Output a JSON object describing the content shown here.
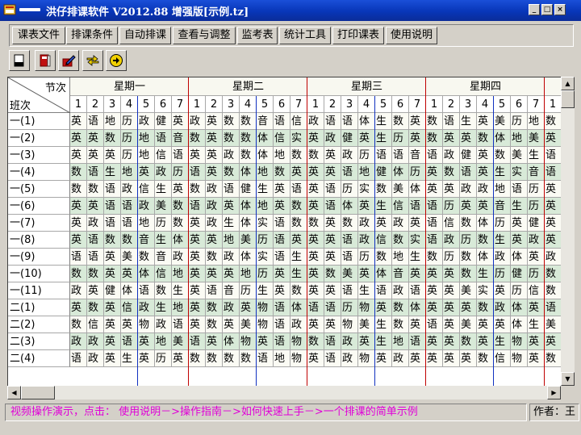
{
  "window": {
    "title": "洪仔排课软件 V2012.88 增强版[示例.tz]",
    "controls": [
      "_",
      "□",
      "×"
    ]
  },
  "menu": {
    "items": [
      "课表文件",
      "排课条件",
      "自动排课",
      "查看与调整",
      "监考表",
      "统计工具",
      "打印课表",
      "使用说明"
    ]
  },
  "toolbar": {
    "tools": [
      "new-doc-icon",
      "book-icon",
      "edit-pencil-icon",
      "swap-arrows-icon",
      "arrow-right-circle-icon"
    ]
  },
  "grid": {
    "corner_top": "节次",
    "corner_bottom": "班次",
    "days": [
      "星期一",
      "星期二",
      "星期三",
      "星期四"
    ],
    "periods_per_day": [
      "1",
      "2",
      "3",
      "4",
      "5",
      "6",
      "7"
    ],
    "extra_period": "1",
    "rows": [
      {
        "label": "一(1)",
        "cells": [
          "英",
          "语",
          "地",
          "历",
          "政",
          "健",
          "英",
          "政",
          "英",
          "数",
          "数",
          "音",
          "语",
          "信",
          "政",
          "语",
          "语",
          "体",
          "生",
          "数",
          "英",
          "数",
          "语",
          "生",
          "英",
          "美",
          "历",
          "地",
          "数"
        ]
      },
      {
        "label": "一(2)",
        "cells": [
          "英",
          "英",
          "数",
          "历",
          "地",
          "语",
          "音",
          "数",
          "英",
          "数",
          "数",
          "体",
          "信",
          "实",
          "英",
          "政",
          "健",
          "英",
          "生",
          "历",
          "英",
          "数",
          "英",
          "英",
          "数",
          "体",
          "地",
          "美",
          "英"
        ]
      },
      {
        "label": "一(3)",
        "cells": [
          "英",
          "英",
          "英",
          "历",
          "地",
          "信",
          "语",
          "英",
          "英",
          "政",
          "数",
          "体",
          "地",
          "数",
          "数",
          "英",
          "政",
          "历",
          "语",
          "语",
          "音",
          "语",
          "政",
          "健",
          "英",
          "数",
          "美",
          "生",
          "语"
        ]
      },
      {
        "label": "一(4)",
        "cells": [
          "数",
          "语",
          "生",
          "地",
          "英",
          "政",
          "历",
          "语",
          "英",
          "数",
          "体",
          "地",
          "数",
          "英",
          "英",
          "英",
          "语",
          "地",
          "健",
          "体",
          "历",
          "英",
          "数",
          "语",
          "英",
          "生",
          "实",
          "音",
          "语"
        ]
      },
      {
        "label": "一(5)",
        "cells": [
          "数",
          "数",
          "语",
          "政",
          "信",
          "生",
          "英",
          "数",
          "政",
          "语",
          "健",
          "生",
          "英",
          "语",
          "英",
          "语",
          "历",
          "实",
          "数",
          "美",
          "体",
          "英",
          "英",
          "政",
          "政",
          "地",
          "语",
          "历",
          "英"
        ]
      },
      {
        "label": "一(6)",
        "cells": [
          "英",
          "英",
          "语",
          "语",
          "政",
          "美",
          "数",
          "语",
          "政",
          "英",
          "体",
          "地",
          "英",
          "数",
          "英",
          "语",
          "体",
          "英",
          "生",
          "信",
          "语",
          "语",
          "历",
          "英",
          "英",
          "音",
          "生",
          "历",
          "英"
        ]
      },
      {
        "label": "一(7)",
        "cells": [
          "英",
          "政",
          "语",
          "语",
          "地",
          "历",
          "数",
          "英",
          "政",
          "生",
          "体",
          "实",
          "语",
          "数",
          "数",
          "英",
          "数",
          "政",
          "英",
          "政",
          "英",
          "语",
          "信",
          "数",
          "体",
          "历",
          "英",
          "健",
          "英"
        ]
      },
      {
        "label": "一(8)",
        "cells": [
          "英",
          "语",
          "数",
          "数",
          "音",
          "生",
          "体",
          "英",
          "英",
          "地",
          "美",
          "历",
          "语",
          "英",
          "英",
          "英",
          "语",
          "政",
          "信",
          "数",
          "实",
          "语",
          "政",
          "历",
          "数",
          "生",
          "英",
          "政",
          "英"
        ]
      },
      {
        "label": "一(9)",
        "cells": [
          "语",
          "语",
          "英",
          "美",
          "数",
          "音",
          "政",
          "英",
          "数",
          "政",
          "体",
          "实",
          "语",
          "生",
          "英",
          "英",
          "语",
          "历",
          "数",
          "地",
          "生",
          "数",
          "历",
          "数",
          "体",
          "政",
          "体",
          "英",
          "政"
        ]
      },
      {
        "label": "一(10)",
        "cells": [
          "数",
          "数",
          "英",
          "英",
          "体",
          "信",
          "地",
          "英",
          "英",
          "英",
          "地",
          "历",
          "英",
          "生",
          "英",
          "数",
          "美",
          "英",
          "体",
          "音",
          "英",
          "英",
          "英",
          "数",
          "生",
          "历",
          "健",
          "历",
          "数"
        ]
      },
      {
        "label": "一(11)",
        "cells": [
          "政",
          "英",
          "健",
          "体",
          "语",
          "数",
          "生",
          "英",
          "语",
          "音",
          "历",
          "生",
          "英",
          "数",
          "英",
          "英",
          "语",
          "生",
          "语",
          "政",
          "语",
          "英",
          "英",
          "美",
          "实",
          "英",
          "历",
          "信",
          "数"
        ]
      },
      {
        "label": "二(1)",
        "cells": [
          "英",
          "数",
          "英",
          "信",
          "政",
          "生",
          "地",
          "英",
          "数",
          "政",
          "英",
          "物",
          "语",
          "体",
          "语",
          "语",
          "历",
          "物",
          "英",
          "数",
          "体",
          "英",
          "英",
          "英",
          "数",
          "政",
          "体",
          "英",
          "语"
        ]
      },
      {
        "label": "二(2)",
        "cells": [
          "数",
          "信",
          "英",
          "英",
          "物",
          "政",
          "语",
          "英",
          "数",
          "英",
          "美",
          "物",
          "语",
          "政",
          "英",
          "英",
          "物",
          "美",
          "生",
          "数",
          "英",
          "语",
          "英",
          "美",
          "英",
          "英",
          "体",
          "生",
          "美"
        ]
      },
      {
        "label": "二(3)",
        "cells": [
          "政",
          "政",
          "英",
          "语",
          "英",
          "地",
          "美",
          "语",
          "英",
          "体",
          "物",
          "英",
          "语",
          "物",
          "数",
          "语",
          "政",
          "英",
          "生",
          "地",
          "语",
          "英",
          "英",
          "数",
          "英",
          "生",
          "物",
          "英",
          "英"
        ]
      },
      {
        "label": "二(4)",
        "cells": [
          "语",
          "政",
          "英",
          "生",
          "英",
          "历",
          "英",
          "数",
          "数",
          "数",
          "数",
          "语",
          "地",
          "物",
          "英",
          "语",
          "政",
          "物",
          "英",
          "政",
          "英",
          "英",
          "英",
          "英",
          "数",
          "信",
          "物",
          "英",
          "数"
        ]
      }
    ]
  },
  "status": {
    "hint": "视频操作演示，点击： 使用说明－>操作指南－>如何快速上手－>一个排课的简单示例",
    "author": "作者：王"
  }
}
